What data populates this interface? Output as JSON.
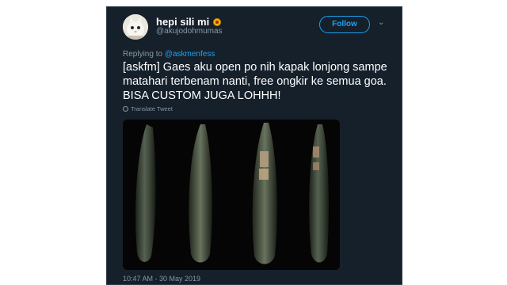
{
  "tweet": {
    "display_name": "hepi sili mi",
    "handle": "@akujodohmumas",
    "follow_label": "Follow",
    "reply_prefix": "Replying to",
    "reply_mention": "@askmenfess",
    "text": "[askfm] Gaes aku open po nih kapak lonjong sampe matahari terbenam nanti,  free ongkir ke semua goa.  BISA CUSTOM JUGA LOHHH!",
    "translate_label": "Translate Tweet",
    "timestamp": "10:47 AM - 30 May 2019"
  },
  "colors": {
    "background": "#15202b",
    "accent": "#1da1f2",
    "secondary_text": "#8899a6"
  },
  "icons": {
    "avatar": "cat-avatar",
    "name_badge": "emoji-badge-icon",
    "menu": "chevron-down-icon",
    "translate": "globe-icon"
  }
}
